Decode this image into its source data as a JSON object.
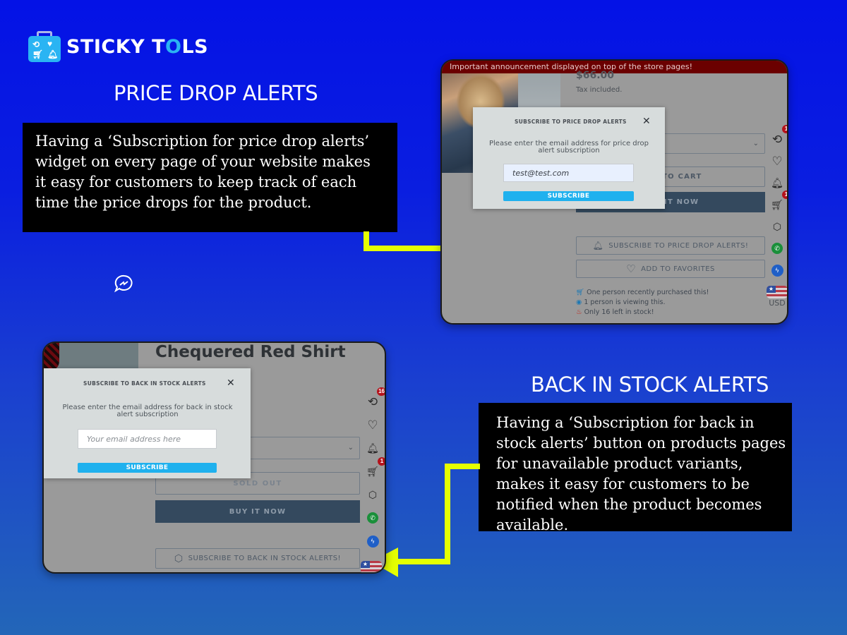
{
  "brand": {
    "name_part1": "STICKY T",
    "name_o": "O",
    "name_part2": "LS",
    "colors": {
      "accent": "#2ab4f3",
      "background_top": "#0412e6",
      "background_bottom": "#2366b8",
      "arrow": "#e5ff00"
    }
  },
  "price_drop": {
    "title": "PRICE DROP ALERTS",
    "description": "Having a ‘Subscription for price drop alerts’ widget on every page of your website makes it easy for customers to keep track of each time the price drops for the product.",
    "store": {
      "announcement": "Important announcement displayed on top of the store pages!",
      "price": "$66.00",
      "tax_note": "Tax included.",
      "add_to_cart_label": "ADD TO CART",
      "buy_now_label": "BUY IT NOW",
      "subscribe_button_label": "SUBSCRIBE TO PRICE DROP ALERTS!",
      "favorites_button_label": "ADD TO FAVORITES",
      "social_proof": [
        {
          "icon": "cart-icon",
          "text": "One person recently purchased this!"
        },
        {
          "icon": "eye-icon",
          "text": "1 person is viewing this."
        },
        {
          "icon": "fire-icon",
          "text": "Only 16 left in stock!"
        }
      ],
      "side_icons": {
        "history_badge": "1",
        "cart_badge": "1",
        "currency": "USD"
      },
      "popup": {
        "title": "SUBSCRIBE TO PRICE DROP ALERTS",
        "close_icon": "close-icon",
        "message": "Please enter the email address for price drop alert subscription",
        "email_value": "test@test.com",
        "submit_label": "SUBSCRIBE"
      }
    }
  },
  "back_in_stock": {
    "title": "BACK IN STOCK ALERTS",
    "description": "Having a ‘Subscription for back in stock alerts’ button on products pages for unavailable product variants, makes it easy for customers to be notified when the product becomes available.",
    "store": {
      "product_title": "Chequered Red Shirt",
      "sold_out_label": "SOLD OUT",
      "buy_now_label": "BUY IT NOW",
      "subscribe_button_label": "SUBSCRIBE TO BACK IN STOCK ALERTS!",
      "side_icons": {
        "history_badge": "16",
        "cart_badge": "1"
      },
      "popup": {
        "title": "SUBSCRIBE TO BACK IN STOCK ALERTS",
        "close_icon": "close-icon",
        "message": "Please enter the email address for back in stock alert subscription",
        "email_value": "",
        "email_placeholder": "Your email address here",
        "submit_label": "SUBSCRIBE"
      }
    }
  },
  "floating_icon": "chat-bubble-icon"
}
